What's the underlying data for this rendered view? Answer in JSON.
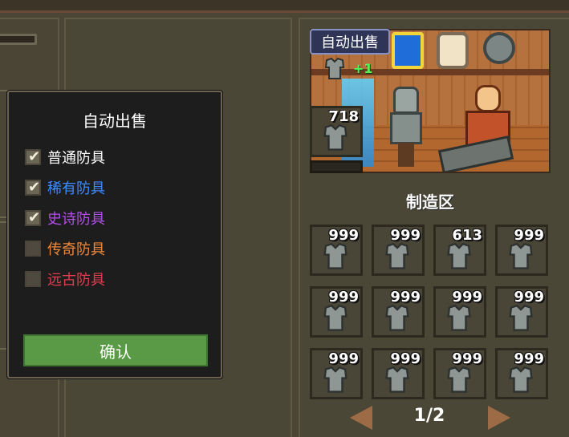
{
  "colors": {
    "normal": "#ffffff",
    "rare": "#3c8cff",
    "epic": "#b24fe8",
    "legendary": "#f0873a",
    "ancient": "#e43c4f",
    "confirm": "#5a9a46",
    "bonus": "#5af05a"
  },
  "shop": {
    "auto_sell_tag": "自动出售",
    "bonus": "+1",
    "stock_count": "718",
    "icons": [
      "shield-blue-icon",
      "shield-white-icon",
      "shield-round-icon",
      "armor-icon"
    ]
  },
  "craft": {
    "title": "制造区",
    "slots": [
      {
        "count": "999",
        "icon": "armor-icon"
      },
      {
        "count": "999",
        "icon": "armor-icon"
      },
      {
        "count": "613",
        "icon": "armor-icon"
      },
      {
        "count": "999",
        "icon": "armor-icon"
      },
      {
        "count": "999",
        "icon": "armor-icon"
      },
      {
        "count": "999",
        "icon": "armor-icon"
      },
      {
        "count": "999",
        "icon": "armor-icon"
      },
      {
        "count": "999",
        "icon": "armor-icon"
      },
      {
        "count": "999",
        "icon": "armor-icon"
      },
      {
        "count": "999",
        "icon": "armor-icon"
      },
      {
        "count": "999",
        "icon": "armor-icon"
      },
      {
        "count": "999",
        "icon": "armor-icon"
      }
    ],
    "page": "1/2"
  },
  "dialog": {
    "title": "自动出售",
    "options": [
      {
        "label": "普通防具",
        "checked": true
      },
      {
        "label": "稀有防具",
        "checked": true
      },
      {
        "label": "史诗防具",
        "checked": true
      },
      {
        "label": "传奇防具",
        "checked": false
      },
      {
        "label": "远古防具",
        "checked": false
      }
    ],
    "confirm": "确认"
  }
}
